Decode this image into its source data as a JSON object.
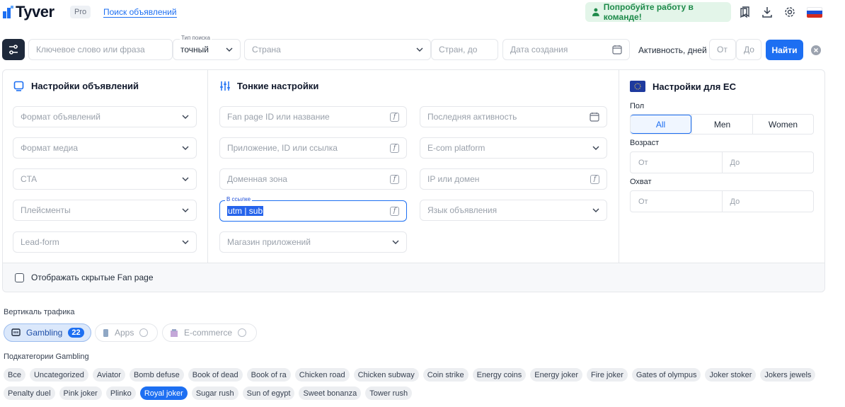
{
  "header": {
    "logo": "Tyver",
    "plan_badge": "Pro",
    "nav_link": "Поиск объявлений",
    "team_button": "Попробуйте работу в команде!"
  },
  "search": {
    "keyword_placeholder": "Ключевое слово или фраза",
    "search_type_label": "Тип поиска",
    "search_type_value": "точный",
    "country_placeholder": "Страна",
    "countries_to_placeholder": "Стран, до",
    "created_date_placeholder": "Дата создания",
    "activity_label": "Активность, дней",
    "activity_from": "От",
    "activity_to": "До",
    "find_button": "Найти"
  },
  "ad_settings": {
    "title": "Настройки объявлений",
    "fields": [
      "Формат объявлений",
      "Формат медиа",
      "CTA",
      "Плейсменты",
      "Lead-form"
    ]
  },
  "fine_settings": {
    "title": "Тонкие настройки",
    "col1": {
      "fanpage": "Fan page ID или название",
      "app": "Приложение, ID или ссылка",
      "domain_zone": "Доменная зона",
      "link_label": "В ссылке",
      "link_value": "utm | sub",
      "app_store": "Магазин приложений"
    },
    "col2": {
      "last_activity": "Последняя активность",
      "ecom": "E-com platform",
      "ip_domain": "IP или домен",
      "ad_language": "Язык объявления"
    }
  },
  "eu_settings": {
    "title": "Настройки для ЕС",
    "gender_label": "Пол",
    "genders": [
      "All",
      "Men",
      "Women"
    ],
    "selected_gender": "All",
    "age_label": "Возраст",
    "age_from": "От",
    "age_to": "До",
    "reach_label": "Охват",
    "reach_from": "От",
    "reach_to": "До"
  },
  "hidden_fanpage_label": "Отображать скрытые Fan page",
  "verticals": {
    "label": "Вертикаль трафика",
    "items": [
      {
        "label": "Gambling",
        "count": "22",
        "active": true
      },
      {
        "label": "Apps",
        "active": false
      },
      {
        "label": "E-commerce",
        "active": false
      }
    ]
  },
  "subcategories": {
    "label": "Подкатегории Gambling",
    "row1": [
      "Все",
      "Uncategorized",
      "Aviator",
      "Bomb defuse",
      "Book of dead",
      "Book of ra",
      "Chicken road",
      "Chicken subway",
      "Coin strike",
      "Energy coins",
      "Energy joker",
      "Fire joker",
      "Gates of olympus",
      "Joker stoker",
      "Jokers jewels"
    ],
    "row2": [
      "Penalty duel",
      "Pink joker",
      "Plinko",
      "Royal joker",
      "Sugar rush",
      "Sun of egypt",
      "Sweet bonanza",
      "Tower rush"
    ],
    "selected": "Royal joker"
  },
  "colors": {
    "accent": "#1d6ff2",
    "dark_button": "#1e293b",
    "team_bg": "#e3f5e9",
    "team_text": "#1e8a4a"
  }
}
